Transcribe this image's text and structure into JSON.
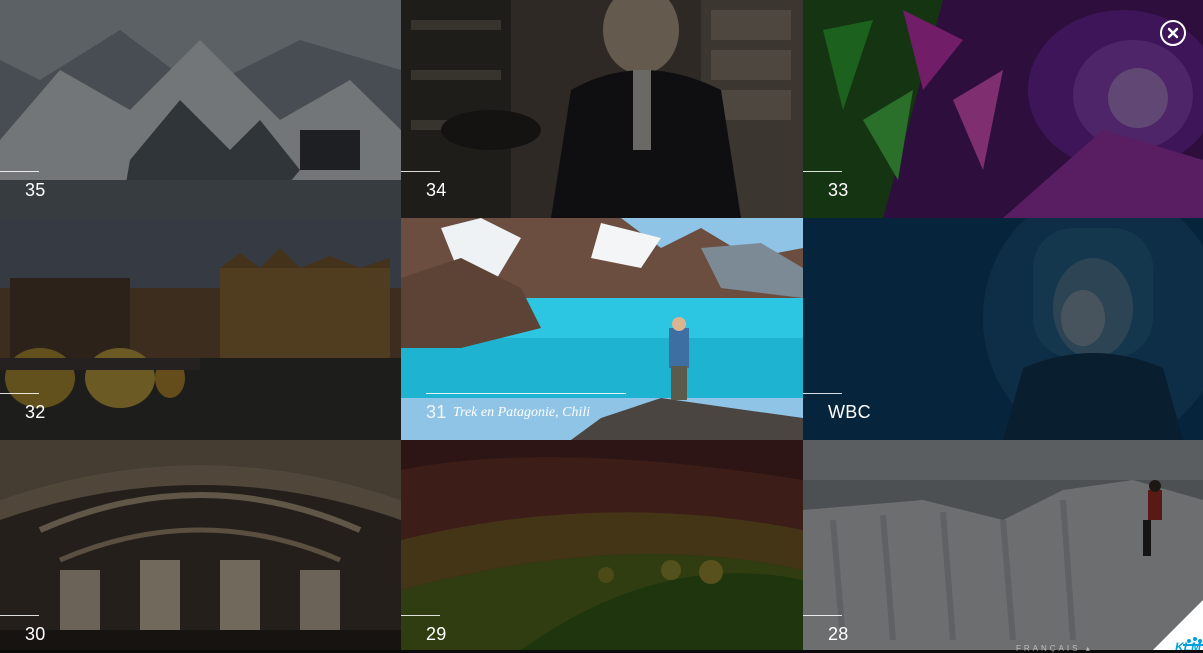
{
  "gallery": {
    "tiles": [
      {
        "number": "35",
        "caption": "",
        "active": false
      },
      {
        "number": "34",
        "caption": "",
        "active": false
      },
      {
        "number": "33",
        "caption": "",
        "active": false
      },
      {
        "number": "32",
        "caption": "",
        "active": false
      },
      {
        "number": "31",
        "caption": "Trek en Patagonie, Chili",
        "active": true
      },
      {
        "number": "WBC",
        "caption": "",
        "active": false
      },
      {
        "number": "30",
        "caption": "",
        "active": false
      },
      {
        "number": "29",
        "caption": "",
        "active": false
      },
      {
        "number": "28",
        "caption": "",
        "active": false
      }
    ]
  },
  "footer": {
    "language_label": "FRANÇAIS",
    "brand_logo_text": "KLM"
  },
  "icons": {
    "close": "close-icon",
    "dropdown": "chevron-up-icon",
    "logo": "klm-crown-logo"
  },
  "colors": {
    "overlay": "#000000",
    "accent_blue": "#00a1de",
    "text": "#ffffff"
  }
}
